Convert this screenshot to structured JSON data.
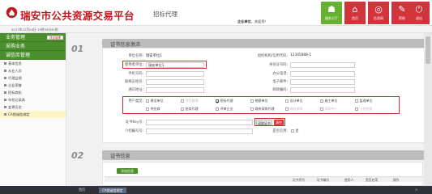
{
  "header": {
    "site_title": "瑞安市公共资源交易平台",
    "section_title": "招标代理",
    "login_label": "企业单位",
    "login_greeting": "，欢迎您！",
    "tiles": [
      {
        "label": "服务大厅",
        "icon": "service-hall-icon"
      },
      {
        "label": "首页",
        "icon": "home-icon"
      },
      {
        "label": "信息网",
        "icon": "info-network-icon"
      },
      {
        "label": "帮助",
        "icon": "help-icon"
      },
      {
        "label": "退出",
        "icon": "power-icon"
      }
    ]
  },
  "subbar": {
    "datetime": "2017年12月04日 15时35分41秒"
  },
  "sidebar": {
    "groups": [
      {
        "label": "业务管理",
        "mini": "项目管理"
      },
      {
        "label": "采购业务"
      },
      {
        "label": "诚信库管理"
      }
    ],
    "items": [
      "基本信息",
      "从业人员",
      "代理业绩",
      "企业荣誉",
      "招标商机",
      "年检记录表",
      "变更历史",
      "CA锁诚信绑定"
    ]
  },
  "section1": {
    "number": "01",
    "title": "证书信息激活",
    "fields": {
      "unit_name_label": "单位名称:",
      "unit_name_value": "瑞安单位1",
      "org_code_label": "组织机构/信用代码:",
      "org_code_value": "12345888-1",
      "user_unit_label": "使用者单位:",
      "user_unit_value": "瑞安单位1",
      "id_label": "身份证号码:",
      "phone_label": "手机号码:",
      "office_phone_label": "办公电话:",
      "contact_name_label": "联络员姓名:",
      "fax_label": "传真号码:",
      "address_label": "通讯地址:",
      "postal_label": "邮政编码:",
      "email_label": "电子邮件:",
      "user_type_label": "用户类型:",
      "cert_key_label": "证书Key号:",
      "read_cert_button": "读取证书",
      "clear_button": "清空",
      "intro_label": "介绍编号号:",
      "enabled_label": "是否启用:",
      "enabled_value": "是"
    },
    "user_types_row1": [
      {
        "label": "建设单位",
        "checked": false,
        "disabled": false
      },
      {
        "label": "项目管理",
        "checked": false,
        "disabled": true
      },
      {
        "label": "招标代理",
        "checked": true,
        "disabled": false
      },
      {
        "label": "勘察单位",
        "checked": false,
        "disabled": false
      },
      {
        "label": "设计单位",
        "checked": false,
        "disabled": false
      },
      {
        "label": "施工单位",
        "checked": false,
        "disabled": false
      },
      {
        "label": "监理单位",
        "checked": false,
        "disabled": false
      }
    ],
    "user_types_row2": [
      {
        "label": "供应商",
        "checked": false,
        "disabled": false
      },
      {
        "label": "拍卖代理",
        "checked": false,
        "disabled": false
      },
      {
        "label": "评审企业",
        "checked": false,
        "disabled": false
      },
      {
        "label": "政府采购代理",
        "checked": false,
        "disabled": false
      },
      {
        "label": "政府采购",
        "checked": false,
        "disabled": true
      },
      {
        "label": "采购中心",
        "checked": false,
        "disabled": true
      },
      {
        "label": "土地拍卖",
        "checked": false,
        "disabled": true
      }
    ]
  },
  "section2": {
    "number": "02",
    "title": "证书信息",
    "add_button": "添加信息",
    "columns": [
      "证书序号",
      "证书编号",
      "使用人",
      "是否启用",
      "操作"
    ]
  },
  "taskbar": {
    "items": [
      "首页",
      "CA锁诚信绑定"
    ]
  },
  "colors": {
    "brand_red": "#c0191e",
    "menu_green": "#4a8f2c",
    "tile_green": "#66b032",
    "tile_red": "#d2343c"
  }
}
